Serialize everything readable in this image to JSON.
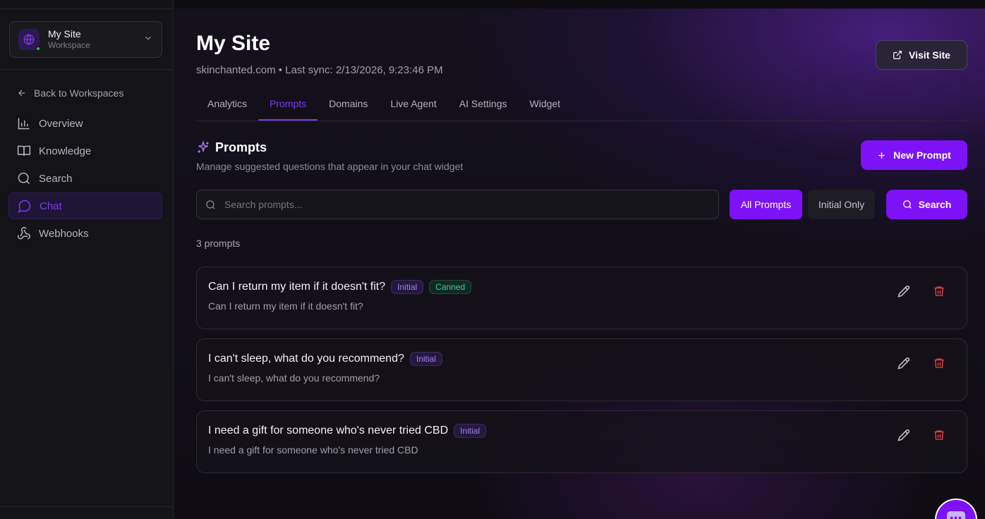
{
  "workspace": {
    "name": "My Site",
    "subtitle": "Workspace",
    "status_color": "#22c55e"
  },
  "sidebar": {
    "back_label": "Back to Workspaces",
    "items": [
      {
        "label": "Overview",
        "icon": "bar-chart-icon",
        "active": false
      },
      {
        "label": "Knowledge",
        "icon": "book-icon",
        "active": false
      },
      {
        "label": "Search",
        "icon": "search-icon",
        "active": false
      },
      {
        "label": "Chat",
        "icon": "chat-bubble-icon",
        "active": true
      },
      {
        "label": "Webhooks",
        "icon": "webhook-icon",
        "active": false
      }
    ]
  },
  "header": {
    "title": "My Site",
    "subtitle": "skinchanted.com • Last sync: 2/13/2026, 9:23:46 PM",
    "visit_label": "Visit Site"
  },
  "tabs": [
    {
      "label": "Analytics",
      "active": false
    },
    {
      "label": "Prompts",
      "active": true
    },
    {
      "label": "Domains",
      "active": false
    },
    {
      "label": "Live Agent",
      "active": false
    },
    {
      "label": "AI Settings",
      "active": false
    },
    {
      "label": "Widget",
      "active": false
    }
  ],
  "section": {
    "title": "Prompts",
    "subtitle": "Manage suggested questions that appear in your chat widget",
    "new_label": "New Prompt"
  },
  "search": {
    "placeholder": "Search prompts...",
    "value": "",
    "filter_all": "All Prompts",
    "filter_initial": "Initial Only",
    "button": "Search"
  },
  "count_label": "3 prompts",
  "prompts": [
    {
      "title": "Can I return my item if it doesn't fit?",
      "description": "Can I return my item if it doesn't fit?",
      "badges": [
        "Initial",
        "Canned"
      ]
    },
    {
      "title": "I can't sleep, what do you recommend?",
      "description": "I can't sleep, what do you recommend?",
      "badges": [
        "Initial"
      ]
    },
    {
      "title": "I need a gift for someone who's never tried CBD",
      "description": "I need a gift for someone who's never tried CBD",
      "badges": [
        "Initial"
      ]
    }
  ],
  "colors": {
    "accent": "#7c12f5",
    "active_text": "#7c3aed",
    "danger": "#ef4444",
    "success": "#34d399"
  }
}
